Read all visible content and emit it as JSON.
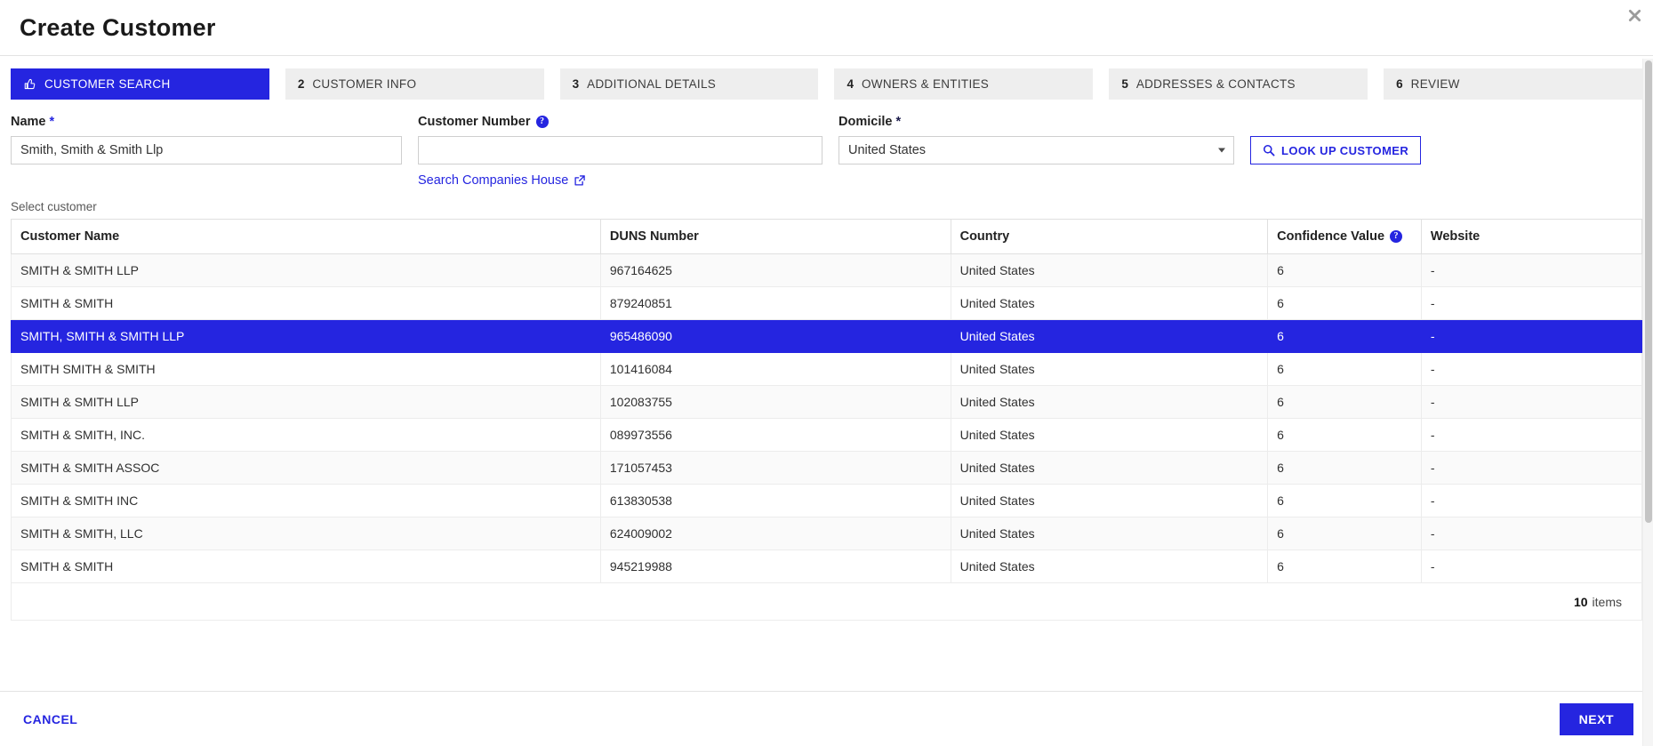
{
  "header": {
    "title": "Create Customer",
    "close_icon": "close-icon"
  },
  "stepper": {
    "tabs": [
      {
        "num": "",
        "label": "CUSTOMER SEARCH",
        "icon": "check-hand-icon",
        "active": true
      },
      {
        "num": "2",
        "label": "CUSTOMER INFO",
        "active": false
      },
      {
        "num": "3",
        "label": "ADDITIONAL DETAILS",
        "active": false
      },
      {
        "num": "4",
        "label": "OWNERS & ENTITIES",
        "active": false
      },
      {
        "num": "5",
        "label": "ADDRESSES & CONTACTS",
        "active": false
      },
      {
        "num": "6",
        "label": "REVIEW",
        "active": false
      }
    ]
  },
  "form": {
    "name": {
      "label": "Name",
      "required_mark": "*",
      "value": "Smith, Smith & Smith Llp",
      "placeholder": ""
    },
    "customer_number": {
      "label": "Customer Number",
      "value": "",
      "placeholder": "",
      "help_icon": "help-circle-icon"
    },
    "domicile": {
      "label": "Domicile",
      "required_mark": "*",
      "value": "United States",
      "caret_icon": "chevron-down-icon"
    },
    "lookup_button": {
      "label": "LOOK UP CUSTOMER",
      "icon": "search-icon"
    },
    "companies_house_link": {
      "label": "Search Companies House",
      "icon": "external-link-icon"
    }
  },
  "table": {
    "caption": "Select customer",
    "columns": [
      {
        "label": "Customer Name"
      },
      {
        "label": "DUNS Number"
      },
      {
        "label": "Country"
      },
      {
        "label": "Confidence Value",
        "help_icon": "help-circle-icon"
      },
      {
        "label": "Website"
      }
    ],
    "rows": [
      {
        "name": "SMITH & SMITH LLP",
        "duns": "967164625",
        "country": "United States",
        "confidence": "6",
        "website": "-",
        "selected": false
      },
      {
        "name": "SMITH & SMITH",
        "duns": "879240851",
        "country": "United States",
        "confidence": "6",
        "website": "-",
        "selected": false
      },
      {
        "name": "SMITH, SMITH & SMITH LLP",
        "duns": "965486090",
        "country": "United States",
        "confidence": "6",
        "website": "-",
        "selected": true
      },
      {
        "name": "SMITH SMITH & SMITH",
        "duns": "101416084",
        "country": "United States",
        "confidence": "6",
        "website": "-",
        "selected": false
      },
      {
        "name": "SMITH & SMITH LLP",
        "duns": "102083755",
        "country": "United States",
        "confidence": "6",
        "website": "-",
        "selected": false
      },
      {
        "name": "SMITH & SMITH, INC.",
        "duns": "089973556",
        "country": "United States",
        "confidence": "6",
        "website": "-",
        "selected": false
      },
      {
        "name": "SMITH & SMITH ASSOC",
        "duns": "171057453",
        "country": "United States",
        "confidence": "6",
        "website": "-",
        "selected": false
      },
      {
        "name": "SMITH & SMITH INC",
        "duns": "613830538",
        "country": "United States",
        "confidence": "6",
        "website": "-",
        "selected": false
      },
      {
        "name": "SMITH & SMITH, LLC",
        "duns": "624009002",
        "country": "United States",
        "confidence": "6",
        "website": "-",
        "selected": false
      },
      {
        "name": "SMITH & SMITH",
        "duns": "945219988",
        "country": "United States",
        "confidence": "6",
        "website": "-",
        "selected": false
      }
    ],
    "footer": {
      "count": "10",
      "count_label": "items"
    }
  },
  "actions": {
    "cancel_label": "CANCEL",
    "next_label": "NEXT"
  },
  "colors": {
    "accent": "#2525e0",
    "tab_inactive_bg": "#eeeeee",
    "row_alt_bg": "#fafafa",
    "border": "#e0e0e0"
  }
}
